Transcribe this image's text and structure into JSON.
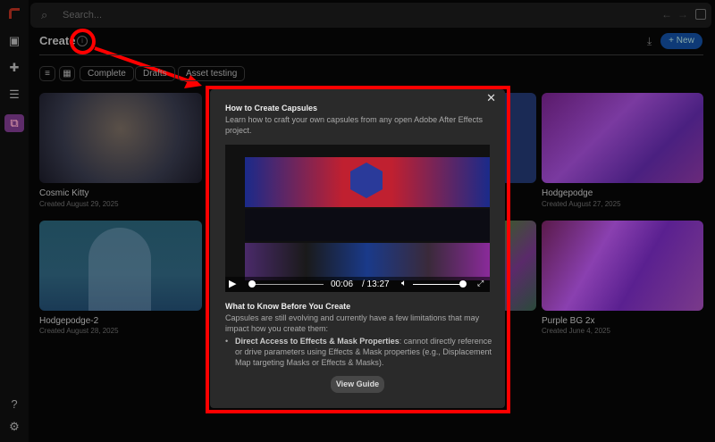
{
  "search": {
    "placeholder": "Search..."
  },
  "header": {
    "title": "Create",
    "new_label": "New"
  },
  "filters": [
    "Complete",
    "Drafts",
    "Asset testing"
  ],
  "cards": [
    {
      "name": "Cosmic Kitty",
      "date": "Created August 29, 2025"
    },
    {
      "name": "Hodgepodge",
      "date": "Created August 27, 2025"
    },
    {
      "name": "Hodgepodge-2",
      "date": "Created August 28, 2025"
    },
    {
      "name": "Purple BG 2x",
      "date": "Created June 4, 2025"
    }
  ],
  "modal": {
    "title": "How to Create Capsules",
    "intro": "Learn how to craft your own capsules from any open Adobe After Effects project.",
    "video": {
      "current": "00:06",
      "duration": "/ 13:27",
      "progress": 0.008,
      "volume": 0.85
    },
    "section_title": "What to Know Before You Create",
    "section_text": "Capsules are still evolving and currently have a few limitations that may impact how you create them:",
    "bullet_bold": "Direct Access to Effects & Mask Properties",
    "bullet_text": ": cannot directly reference or drive parameters using Effects & Mask properties (e.g., Displacement Map targeting Masks or Effects & Masks).",
    "button": "View Guide"
  },
  "colors": {
    "accent": "#0e3a77",
    "annotation": "#ff0000",
    "active_sidebar": "#7a3a8a"
  }
}
